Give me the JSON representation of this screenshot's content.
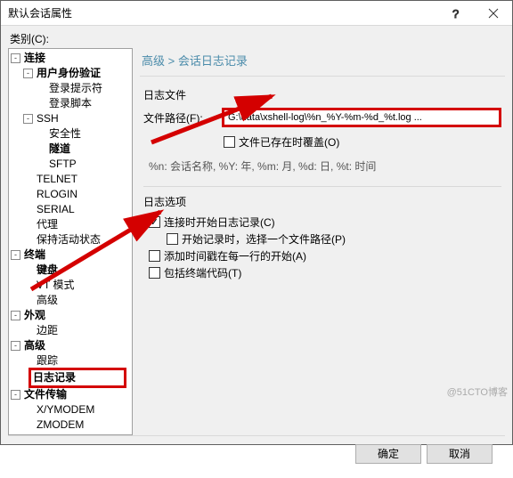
{
  "window": {
    "title": "默认会话属性",
    "help_icon": "?",
    "close_icon": "×"
  },
  "category_label": "类别(C):",
  "breadcrumb": "高级 > 会话日志记录",
  "tree": {
    "connection": {
      "label": "连接",
      "toggle": "-"
    },
    "auth": {
      "label": "用户身份验证",
      "toggle": "-"
    },
    "login_prompt": {
      "label": "登录提示符"
    },
    "login_script": {
      "label": "登录脚本"
    },
    "ssh": {
      "label": "SSH",
      "toggle": "-"
    },
    "security": {
      "label": "安全性"
    },
    "tunnel": {
      "label": "隧道"
    },
    "sftp": {
      "label": "SFTP"
    },
    "telnet": {
      "label": "TELNET"
    },
    "rlogin": {
      "label": "RLOGIN"
    },
    "serial": {
      "label": "SERIAL"
    },
    "proxy": {
      "label": "代理"
    },
    "keepalive": {
      "label": "保持活动状态"
    },
    "terminal": {
      "label": "终端",
      "toggle": "-"
    },
    "keyboard": {
      "label": "键盘"
    },
    "vtmode": {
      "label": "VT 模式"
    },
    "adv": {
      "label": "高级"
    },
    "appearance": {
      "label": "外观",
      "toggle": "-"
    },
    "margin": {
      "label": "边距"
    },
    "advanced": {
      "label": "高级",
      "toggle": "-"
    },
    "trace": {
      "label": "跟踪"
    },
    "logging": {
      "label": "日志记录"
    },
    "filetrans": {
      "label": "文件传输",
      "toggle": "-"
    },
    "xymodem": {
      "label": "X/YMODEM"
    },
    "zmodem": {
      "label": "ZMODEM"
    }
  },
  "log_file_section": "日志文件",
  "file_path_label": "文件路径(F):",
  "file_path_value": "G:\\data\\xshell-log\\%n_%Y-%m-%d_%t.log ...",
  "overwrite_label": "文件已存在时覆盖(O)",
  "format_hint": "%n: 会话名称, %Y: 年, %m: 月, %d: 日, %t: 时间",
  "log_options_section": "日志选项",
  "start_on_connect_label": "连接时开始日志记录(C)",
  "ask_path_label": "开始记录时，选择一个文件路径(P)",
  "timestamp_label": "添加时间戳在每一行的开始(A)",
  "terminal_code_label": "包括终端代码(T)",
  "buttons": {
    "ok": "确定",
    "cancel": "取消"
  },
  "watermark": "@51CTO博客"
}
